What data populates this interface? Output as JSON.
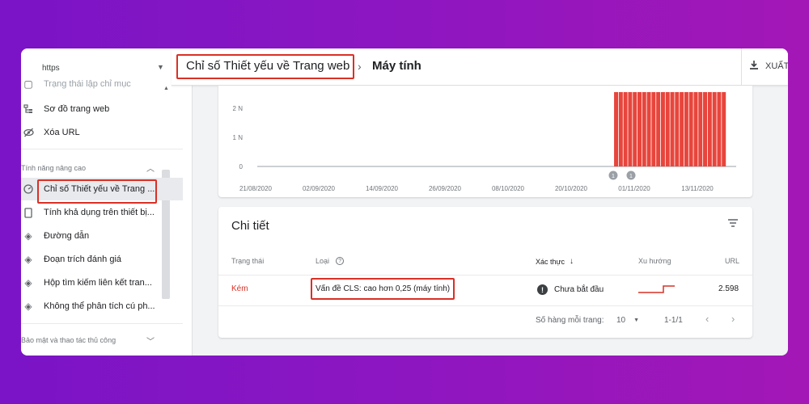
{
  "property": {
    "value": "https"
  },
  "sidebar": {
    "items_top": [
      {
        "label": "Trạng thái lập chỉ mục",
        "icon": "index-status-icon"
      },
      {
        "label": "Sơ đồ trang web",
        "icon": "sitemap-icon"
      },
      {
        "label": "Xóa URL",
        "icon": "remove-url-icon"
      }
    ],
    "section_enhancements": "Tính năng nâng cao",
    "items_enh": [
      {
        "label": "Chỉ số Thiết yếu về Trang ...",
        "icon": "gauge-icon",
        "active": true
      },
      {
        "label": "Tính khả dụng trên thiết bị...",
        "icon": "mobile-icon"
      },
      {
        "label": "Đường dẫn",
        "icon": "layers-icon"
      },
      {
        "label": "Đoạn trích đánh giá",
        "icon": "layers-icon"
      },
      {
        "label": "Hộp tìm kiếm liên kết tran...",
        "icon": "layers-icon"
      },
      {
        "label": "Không thể phân tích cú ph...",
        "icon": "layers-icon"
      }
    ],
    "section_security": "Bảo mật và thao tác thủ công"
  },
  "header": {
    "breadcrumb_parent": "Chỉ số Thiết yếu về Trang web",
    "breadcrumb_current": "Máy tính",
    "export_label": "XUẤT"
  },
  "chart_data": {
    "type": "bar",
    "y_ticks": [
      "2 N",
      "1 N",
      "0"
    ],
    "x_ticks": [
      "21/08/2020",
      "02/09/2020",
      "14/09/2020",
      "26/09/2020",
      "08/10/2020",
      "20/10/2020",
      "01/11/2020",
      "13/11/2020"
    ],
    "ylim": [
      0,
      2000
    ],
    "bar_color": "#e8453c",
    "bars_start_fraction": 0.745,
    "bars_count": 24,
    "bar_value": 2000,
    "annotations": [
      "1",
      "1"
    ]
  },
  "details": {
    "title": "Chi tiết",
    "columns": {
      "status": "Trạng thái",
      "type": "Loại",
      "validation": "Xác thực",
      "trend": "Xu hướng",
      "urls": "URL"
    },
    "rows": [
      {
        "status": "Kém",
        "type": "Vấn đề CLS: cao hơn 0,25 (máy tính)",
        "validation": "Chưa bắt đầu",
        "urls": "2.598"
      }
    ],
    "pagination": {
      "rows_per_page_label": "Số hàng mỗi trang:",
      "rows_per_page": "10",
      "range": "1-1/1"
    }
  },
  "colors": {
    "highlight": "#d93025",
    "bad": "#d93025",
    "bars": "#e8453c"
  }
}
